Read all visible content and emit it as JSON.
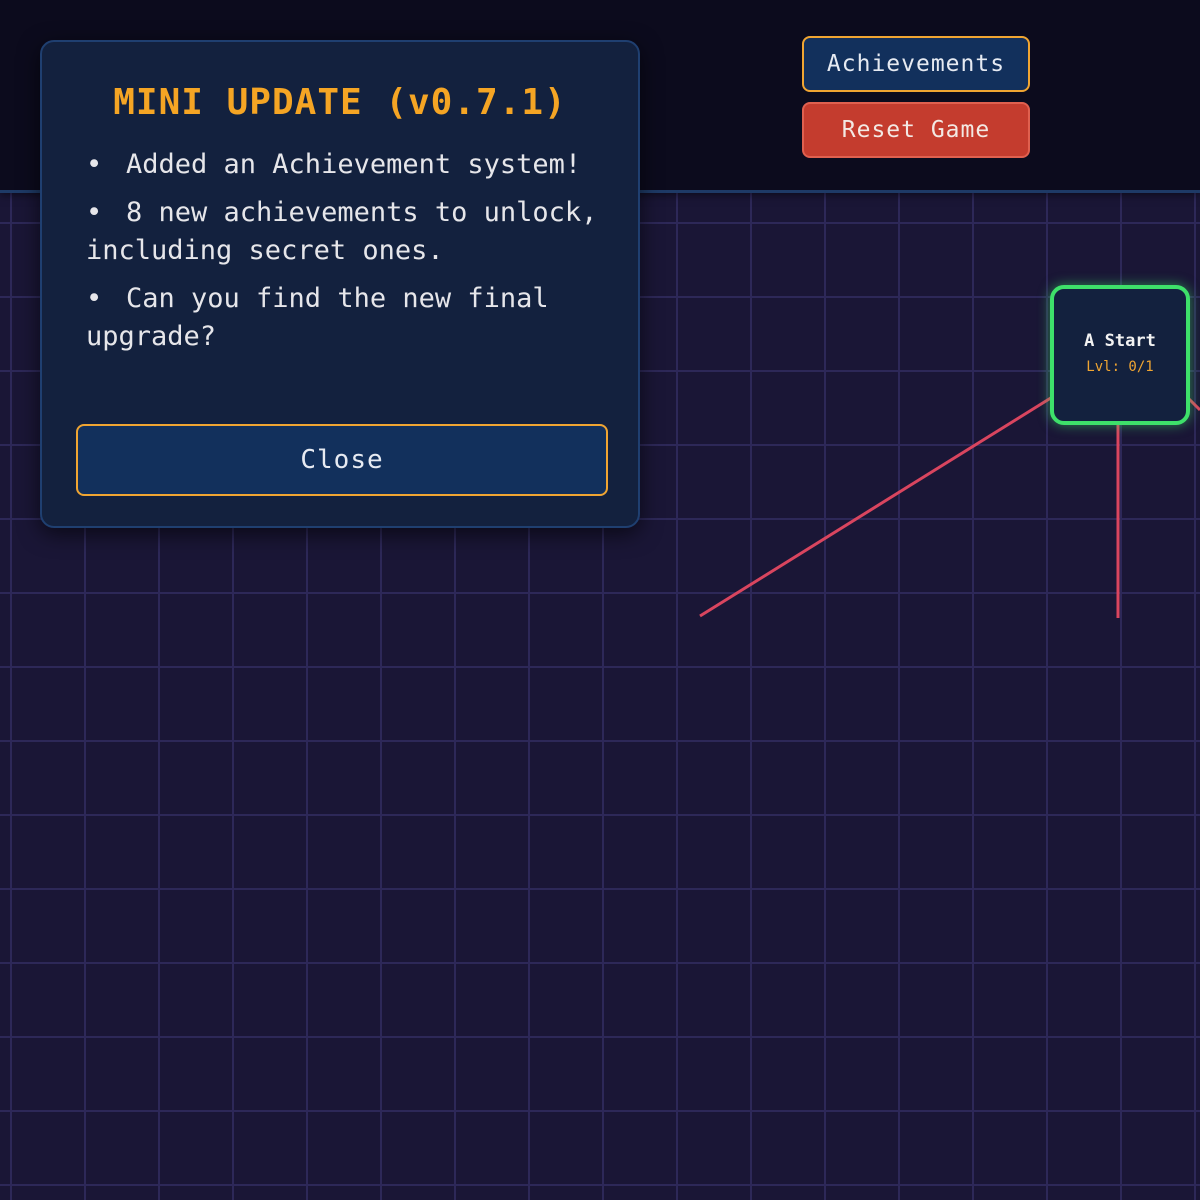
{
  "topbar": {
    "achievements_label": "Achievements",
    "reset_label": "Reset Game"
  },
  "update_modal": {
    "title": "MINI UPDATE (v0.7.1)",
    "notes": [
      "Added an Achievement system!",
      "8 new achievements to unlock, including secret ones.",
      "Can you find the new final upgrade?"
    ],
    "close_label": "Close"
  },
  "skill_tree": {
    "nodes": [
      {
        "name": "A Start",
        "level_text": "Lvl: 0/1",
        "state": "unlocked"
      }
    ]
  },
  "colors": {
    "background": "#1a1636",
    "accent": "#f5a524",
    "node_border": "#3ee06a",
    "link": "#d9455f",
    "reset": "#c43c2e"
  }
}
